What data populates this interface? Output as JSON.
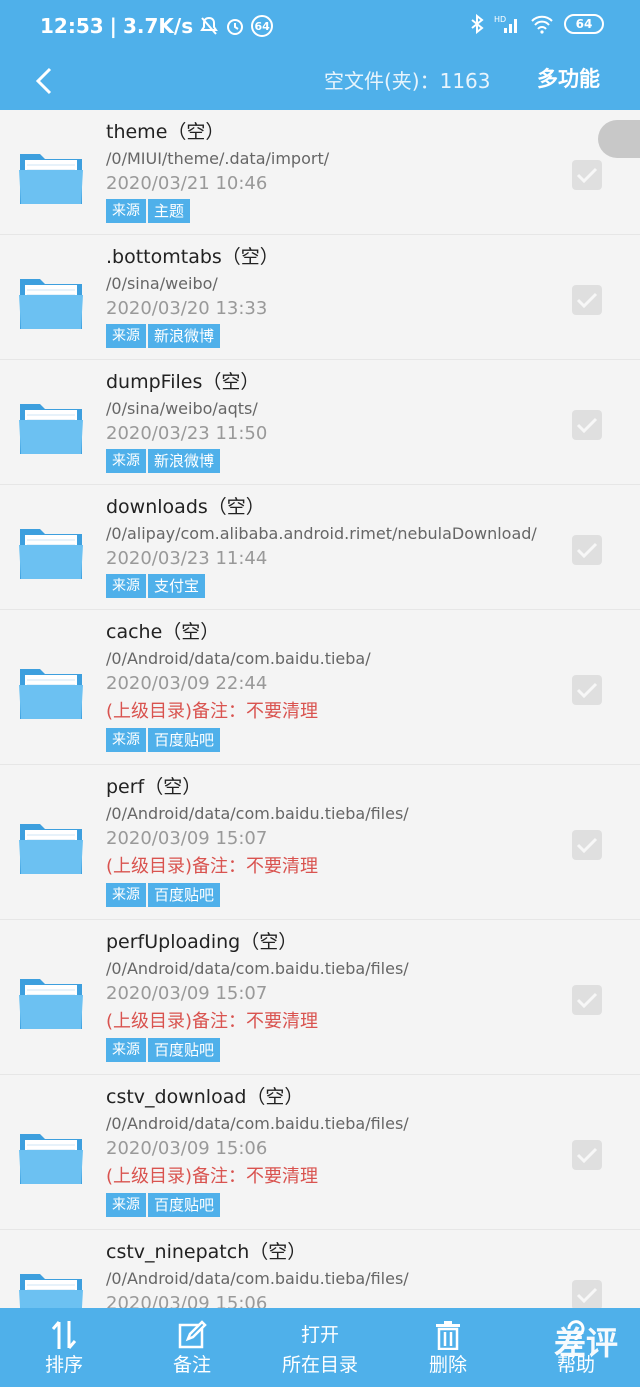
{
  "status_bar": {
    "time": "12:53",
    "net_speed": "3.7K/s",
    "left_badge": "64",
    "battery": "64",
    "network": "HD"
  },
  "app_bar": {
    "empty_count_label": "空文件(夹)：1163",
    "multi_function": "多功能"
  },
  "list": [
    {
      "name": "theme（空）",
      "path": "/0/MIUI/theme/.data/import/",
      "date": "2020/03/21 10:46",
      "note": "",
      "source_label": "来源",
      "source": "主题"
    },
    {
      "name": ".bottomtabs（空）",
      "path": "/0/sina/weibo/",
      "date": "2020/03/20 13:33",
      "note": "",
      "source_label": "来源",
      "source": "新浪微博"
    },
    {
      "name": "dumpFiles（空）",
      "path": "/0/sina/weibo/aqts/",
      "date": "2020/03/23 11:50",
      "note": "",
      "source_label": "来源",
      "source": "新浪微博"
    },
    {
      "name": "downloads（空）",
      "path": "/0/alipay/com.alibaba.android.rimet/nebulaDownload/",
      "date": "2020/03/23 11:44",
      "note": "",
      "source_label": "来源",
      "source": "支付宝"
    },
    {
      "name": "cache（空）",
      "path": "/0/Android/data/com.baidu.tieba/",
      "date": "2020/03/09 22:44",
      "note": "(上级目录)备注：不要清理",
      "source_label": "来源",
      "source": "百度贴吧"
    },
    {
      "name": "perf（空）",
      "path": "/0/Android/data/com.baidu.tieba/files/",
      "date": "2020/03/09 15:07",
      "note": "(上级目录)备注：不要清理",
      "source_label": "来源",
      "source": "百度贴吧"
    },
    {
      "name": "perfUploading（空）",
      "path": "/0/Android/data/com.baidu.tieba/files/",
      "date": "2020/03/09 15:07",
      "note": "(上级目录)备注：不要清理",
      "source_label": "来源",
      "source": "百度贴吧"
    },
    {
      "name": "cstv_download（空）",
      "path": "/0/Android/data/com.baidu.tieba/files/",
      "date": "2020/03/09 15:06",
      "note": "(上级目录)备注：不要清理",
      "source_label": "来源",
      "source": "百度贴吧"
    },
    {
      "name": "cstv_ninepatch（空）",
      "path": "/0/Android/data/com.baidu.tieba/files/",
      "date": "2020/03/09 15:06",
      "note": "",
      "source_label": "",
      "source": ""
    }
  ],
  "toolbar": {
    "sort": "排序",
    "note": "备注",
    "open_top": "打开",
    "open_bottom": "所在目录",
    "delete": "删除",
    "help": "帮助"
  },
  "watermark": "差评",
  "colors": {
    "accent": "#4fb0ea",
    "note_red": "#d9534f",
    "background": "#f2f2f2"
  }
}
